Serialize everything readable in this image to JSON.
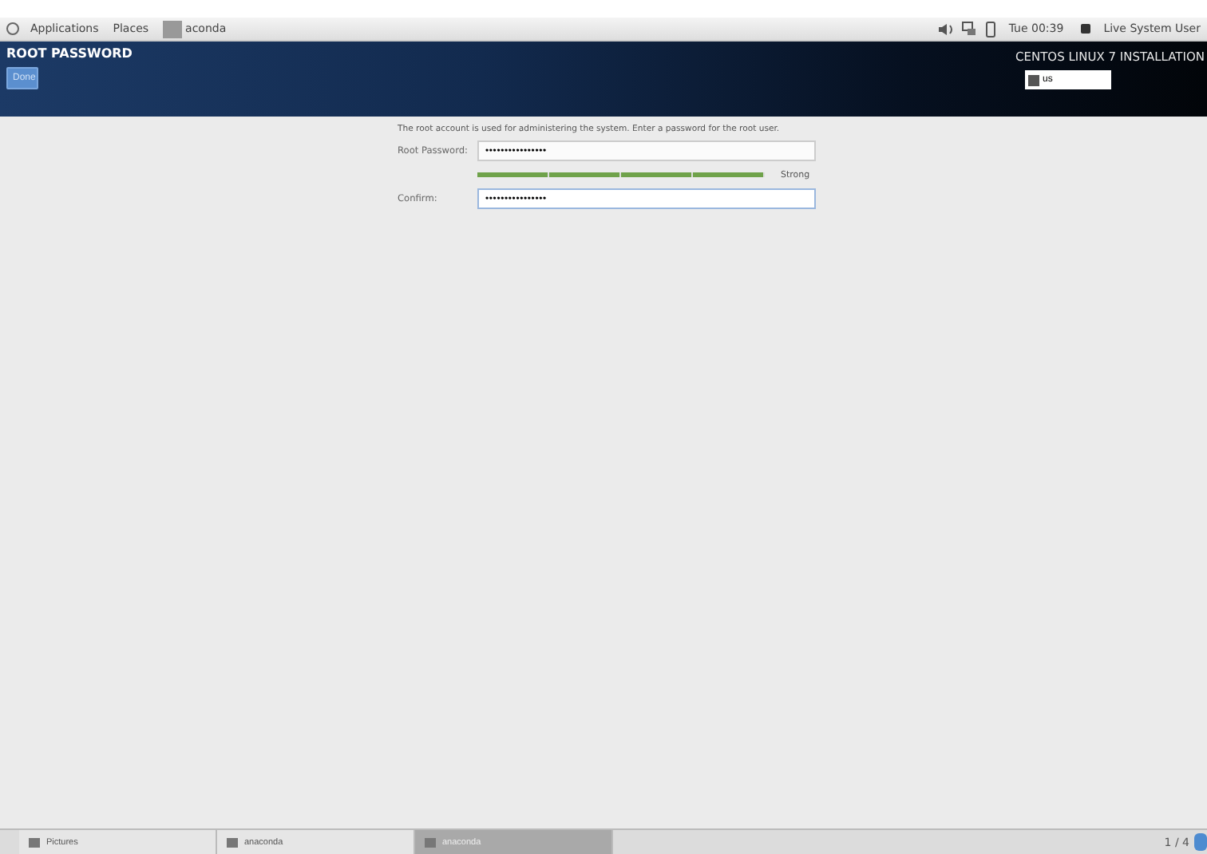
{
  "top_panel": {
    "menus": [
      "Applications",
      "Places"
    ],
    "app": "aconda",
    "clock": "Tue 00:39",
    "user": "Live System User"
  },
  "header": {
    "title": "ROOT PASSWORD",
    "done_button": "Done",
    "product": "CENTOS LINUX 7 INSTALLATION",
    "keyboard": "us"
  },
  "form": {
    "intro": "The root account is used for administering the system.  Enter a password for the root user.",
    "fields": [
      {
        "label": "Root Password:",
        "value": "••••••••••••••••",
        "focused": false
      },
      {
        "label": "Confirm:",
        "value": "••••••••••••••••",
        "focused": true
      }
    ],
    "strength": {
      "level": 1,
      "reading": "Strong"
    }
  },
  "taskbar": {
    "items": [
      {
        "label": "Pictures",
        "selected": false
      },
      {
        "label": "anaconda",
        "selected": false
      },
      {
        "label": "anaconda",
        "selected": true
      }
    ],
    "workspace": "1 / 4"
  }
}
